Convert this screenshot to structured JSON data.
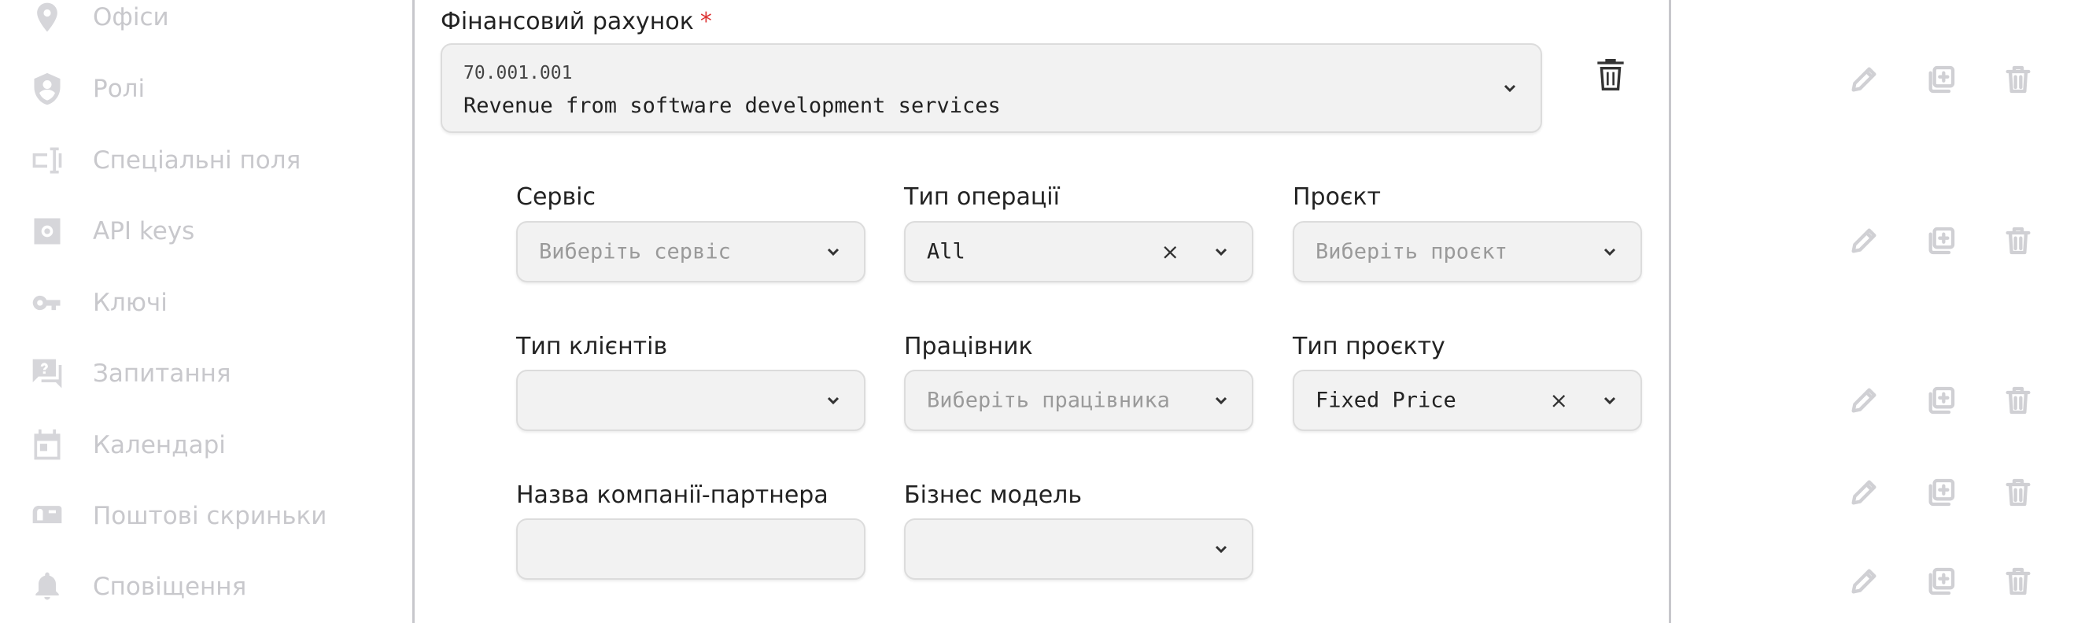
{
  "sidebar": {
    "items": [
      {
        "label": "Офіси",
        "icon": "location-pin-icon"
      },
      {
        "label": "Ролі",
        "icon": "shield-user-icon"
      },
      {
        "label": "Спеціальні поля",
        "icon": "form-field-icon"
      },
      {
        "label": "API keys",
        "icon": "api-gear-icon"
      },
      {
        "label": "Ключі",
        "icon": "key-icon"
      },
      {
        "label": "Запитання",
        "icon": "question-chat-icon"
      },
      {
        "label": "Календарі",
        "icon": "calendar-icon"
      },
      {
        "label": "Поштові скриньки",
        "icon": "mailbox-icon"
      },
      {
        "label": "Сповіщення",
        "icon": "bell-icon"
      }
    ]
  },
  "form": {
    "account": {
      "label": "Фінансовий рахунок",
      "required_mark": "*",
      "code": "70.001.001",
      "name": "Revenue from software development services"
    },
    "fields": {
      "service": {
        "label": "Сервіс",
        "placeholder": "Виберіть сервіс",
        "value": ""
      },
      "operation_type": {
        "label": "Тип операції",
        "placeholder": "",
        "value": "All",
        "clear": "×"
      },
      "project": {
        "label": "Проєкт",
        "placeholder": "Виберіть проєкт",
        "value": ""
      },
      "client_type": {
        "label": "Тип клієнтів",
        "placeholder": "",
        "value": ""
      },
      "employee": {
        "label": "Працівник",
        "placeholder": "Виберіть працівника",
        "value": ""
      },
      "project_type": {
        "label": "Тип проєкту",
        "placeholder": "",
        "value": "Fixed Price",
        "clear": "×"
      },
      "partner_company": {
        "label": "Назва компанії-партнера",
        "placeholder": "",
        "value": ""
      },
      "business_model": {
        "label": "Бізнес модель",
        "placeholder": "",
        "value": ""
      }
    }
  },
  "actions": {
    "icons": [
      "pencil-icon",
      "duplicate-icon",
      "trash-icon"
    ]
  },
  "colors": {
    "required": "#dd3333",
    "sidebar_text": "#c8c8cc",
    "input_bg": "#f2f2f2"
  }
}
